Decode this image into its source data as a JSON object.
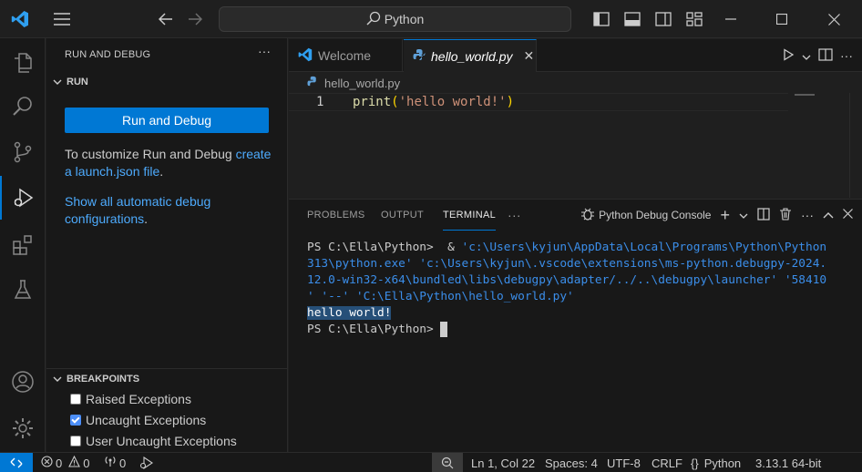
{
  "titlebar": {
    "search_text": "Python",
    "icons": [
      "vscode-logo",
      "menu-icon",
      "arrow-left-icon",
      "arrow-right-icon",
      "search-icon",
      "toggle-sidebar-icon",
      "toggle-panel-icon",
      "toggle-secondary-sidebar-icon",
      "customize-layout-icon",
      "minimize-icon",
      "maximize-icon",
      "close-icon"
    ]
  },
  "activitybar": {
    "items": [
      "explorer-icon",
      "search-icon",
      "source-control-icon",
      "run-debug-icon",
      "extensions-icon",
      "testing-icon",
      "accounts-icon",
      "manage-icon"
    ],
    "active": "run-debug-icon"
  },
  "sidebar": {
    "title": "RUN AND DEBUG",
    "more": "···",
    "run_section": "RUN",
    "run_button": "Run and Debug",
    "desc1_pre": "To customize Run and Debug ",
    "desc1_link": "create a launch.json file",
    "desc1_post": ".",
    "desc2_link": "Show all automatic debug configurations",
    "desc2_post": ".",
    "breakpoints_section": "BREAKPOINTS",
    "breakpoints": [
      {
        "label": "Raised Exceptions",
        "checked": false
      },
      {
        "label": "Uncaught Exceptions",
        "checked": true
      },
      {
        "label": "User Uncaught Exceptions",
        "checked": false
      }
    ]
  },
  "editor": {
    "tabs": [
      {
        "label": "Welcome",
        "active": false
      },
      {
        "label": "hello_world.py",
        "active": true
      }
    ],
    "breadcrumb": "hello_world.py",
    "line_number": "1",
    "code_fn": "print",
    "code_open": "(",
    "code_str": "'hello world!'",
    "code_close": ")"
  },
  "panel": {
    "tabs": [
      "PROBLEMS",
      "OUTPUT",
      "TERMINAL"
    ],
    "active_tab": "TERMINAL",
    "more": "···",
    "terminal_name": "Python Debug Console",
    "terminal_lines": [
      {
        "prompt": "PS C:\\Ella\\Python>  & ",
        "path": "'c:\\Users\\kyjun\\AppData\\Local\\Programs\\Python\\Python"
      },
      {
        "prompt": "",
        "path": "313\\python.exe' 'c:\\Users\\kyjun\\.vscode\\extensions\\ms-python.debugpy-2024."
      },
      {
        "prompt": "",
        "path": "12.0-win32-x64\\bundled\\libs\\debugpy\\adapter/../..\\debugpy\\launcher' '58410"
      },
      {
        "prompt": "",
        "path": "' '--' 'C:\\Ella\\Python\\hello_world.py'"
      }
    ],
    "output_line": "hello world!",
    "final_prompt": "PS C:\\Ella\\Python> "
  },
  "statusbar": {
    "errors": "0",
    "warnings": "0",
    "ports": "0",
    "cursor_pos": "Ln 1, Col 22",
    "spaces": "Spaces: 4",
    "encoding": "UTF-8",
    "eol": "CRLF",
    "language": "Python",
    "interpreter": "3.13.1 64-bit"
  },
  "colors": {
    "accent": "#0078d4",
    "link": "#4daafc",
    "terminal_path": "#3b8eea",
    "string": "#ce9178"
  }
}
